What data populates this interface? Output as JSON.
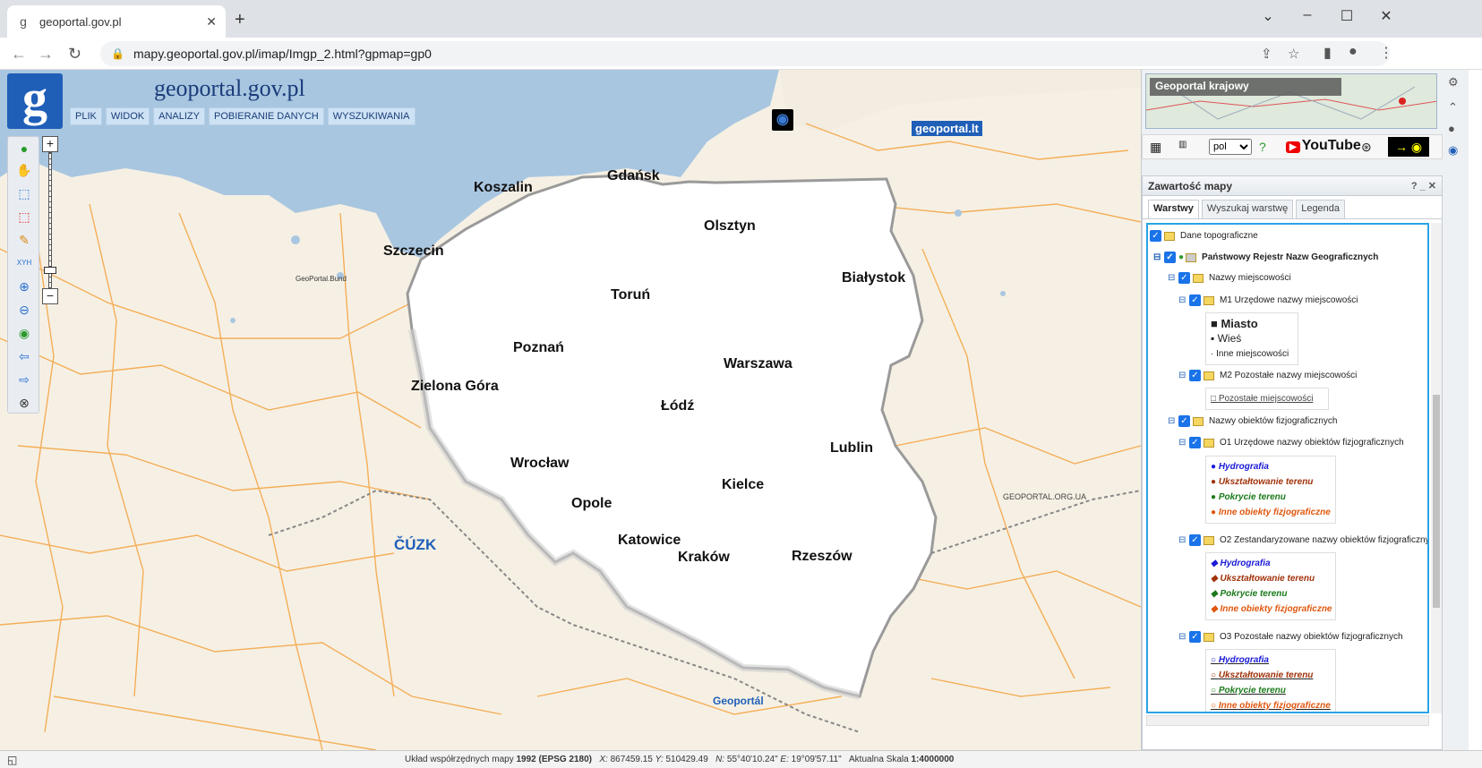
{
  "browser": {
    "tab_title": "geoportal.gov.pl",
    "url": "mapy.geoportal.gov.pl/imap/Imgp_2.html?gpmap=gp0"
  },
  "app": {
    "brand_letter": "g",
    "title": "geoportal.gov.pl",
    "menu": [
      "PLIK",
      "WIDOK",
      "ANALIZY",
      "POBIERANIE DANYCH",
      "WYSZUKIWANIA"
    ]
  },
  "map": {
    "cities": [
      "Gdańsk",
      "Koszalin",
      "Olsztyn",
      "Szczecin",
      "Białystok",
      "Toruń",
      "Poznań",
      "Warszawa",
      "Zielona Góra",
      "Łódź",
      "Lublin",
      "Wrocław",
      "Kielce",
      "Opole",
      "Katowice",
      "Kraków",
      "Rzeszów"
    ],
    "logos": {
      "lt": "geoportal.lt",
      "bund": "GeoPortal.Bund",
      "cuzk": "ČÚZK",
      "sk": "Geoportál",
      "org": "GEOPORTAL.ORG.UA"
    }
  },
  "right_panel": {
    "minimap_caption": "Geoportal krajowy",
    "lang": "pol",
    "youtube": "YouTube",
    "contents_title": "Zawartość mapy",
    "contents_controls": "? _ ✕",
    "tabs": [
      "Warstwy",
      "Wyszukaj warstwę",
      "Legenda"
    ],
    "layers": {
      "dane": "Dane topograficzne",
      "prng": "Państwowy Rejestr Nazw Geograficznych",
      "nazwy_miejsc": "Nazwy miejscowości",
      "m1": "M1 Urzędowe nazwy miejscowości",
      "m1_legend": [
        "Miasto",
        "Wieś",
        "Inne miejscowości"
      ],
      "m2": "M2 Pozostałe nazwy miejscowości",
      "m2_legend": [
        "Pozostałe miejscowości"
      ],
      "nazwy_obj": "Nazwy obiektów fizjograficznych",
      "o1": "O1 Urzędowe nazwy obiektów fizjograficznych",
      "o2": "O2 Zestandaryzowane nazwy obiektów fizjograficznych",
      "o3": "O3 Pozostałe nazwy obiektów fizjograficznych",
      "fiz_legend": [
        "Hydrografia",
        "Ukształtowanie terenu",
        "Pokrycie terenu",
        "Inne obiekty fizjograficzne"
      ],
      "fiz_colors": [
        "#1a1ad6",
        "#a0320a",
        "#1a7a1a",
        "#e0570e"
      ]
    }
  },
  "status": {
    "crs_label": "Układ współrzędnych mapy",
    "crs_value": "1992 (EPSG 2180)",
    "x_label": "X:",
    "x_value": "867459.15",
    "y_label": "Y:",
    "y_value": "510429.49",
    "n_label": "N:",
    "n_value": "55°40'10.24\"",
    "e_label": "E:",
    "e_value": "19°09'57.11\"",
    "scale_label": "Aktualna Skala",
    "scale_value": "1:4000000"
  }
}
